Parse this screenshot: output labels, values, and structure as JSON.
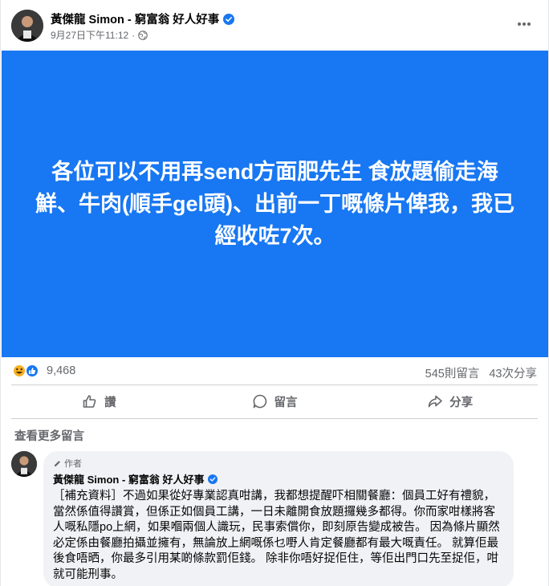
{
  "post": {
    "author": "黃傑龍 Simon - 窮富翁 好人好事",
    "timestamp": "9月27日下午11:12",
    "separator": "·",
    "banner_text": "各位可以不用再send方面肥先生  食放題偷走海鮮、牛肉(順手gel頭)、出前一丁嘅條片俾我，我已經收咗7次。"
  },
  "reactions": {
    "count": "9,468",
    "comments": "545則留言",
    "shares": "43次分享"
  },
  "actions": {
    "like_label": "讚",
    "comment_label": "留言",
    "share_label": "分享"
  },
  "more_comments_label": "查看更多留言",
  "comment": {
    "badge": "作者",
    "author": "黃傑龍 Simon - 窮富翁 好人好事",
    "text": "［補充資料］不過如果從好專業認真咁講，我都想提醒吓相關餐廳：個員工好有禮貌，當然係值得讚賞，但係正如個員工講，一日未離開食放題攞幾多都得。你而家咁樣將客人嘅私隱po上網，如果嗰兩個人識玩，民事索償你，即刻原告變成被告。 因為條片顯然必定係由餐廳拍攝並擁有，無論放上網嘅係乜嘢人肯定餐廳都有最大嘅責任。 就算佢最後食唔晒，你最多引用某啲條款罰佢錢。 除非你唔好捉佢住，等佢出門口先至捉佢，咁就可能刑事。"
  },
  "colors": {
    "banner": "#1877f2",
    "verified": "#1877f2",
    "haha": "#f7b125",
    "like": "#1877f2"
  }
}
